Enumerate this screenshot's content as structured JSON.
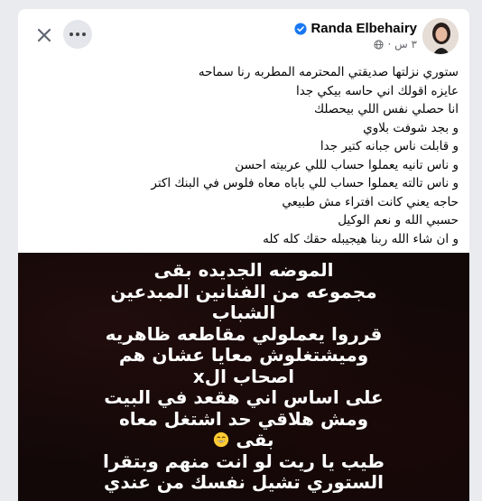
{
  "header": {
    "author_name": "Randa Elbehairy",
    "timestamp": "٣ س ·",
    "icons": {
      "close": "close-icon",
      "more": "more-icon",
      "verified": "verified-badge-icon",
      "audience": "globe-icon"
    }
  },
  "post": {
    "lines": [
      "ستوري نزلتها صديقتي المحترمه المطربه رنا سماحه",
      "عايزه اقولك اني حاسه بيكي جدا",
      "انا حصلي نفس اللي بيحصلك",
      "و بجد شوفت بلاوي",
      "و قابلت ناس جبانه كتير جدا",
      "و ناس تانيه يعملوا حساب لللي عربيته احسن",
      "و ناس تالته يعملوا حساب للي باباه معاه فلوس في البنك اكتر",
      "حاجه يعني كانت افتراء مش طبيعي",
      "حسبي الله و نعم الوكيل",
      "و ان شاء الله ربنا هيجيبله حقك كله كله"
    ]
  },
  "media": {
    "story_lines": [
      "الموضه الجديده بقى",
      "مجموعه من الفنانين المبدعين",
      "الشباب",
      "قرروا يعملولي مقاطعه ظاهريه",
      "وميشتغلوش معايا عشان هم",
      "اصحاب الx",
      "على اساس اني هقعد في البيت",
      "ومش هلاقي حد اشتغل معاه",
      "بقى",
      "طيب يا ريت لو انت منهم وبتقرا",
      "الستوري تشيل نفسك من عندي"
    ],
    "emoji": "grinning-emoji"
  },
  "colors": {
    "background": "#e9ebee",
    "card": "#ffffff",
    "text": "#050505",
    "secondary_text": "#65676b",
    "verified": "#1877f2",
    "media_bg": "#120808"
  }
}
